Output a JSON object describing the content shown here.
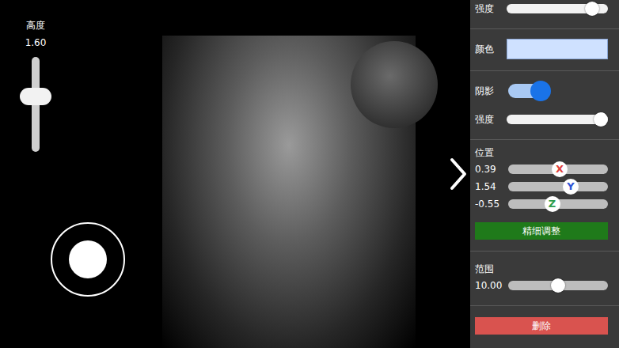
{
  "height_control": {
    "label": "高度",
    "value": "1.60",
    "level": 0.6
  },
  "light_panel": {
    "intensity": {
      "label": "强度",
      "level": 0.9
    },
    "color": {
      "label": "颜色",
      "swatch": "#cfe1ff"
    },
    "shadow": {
      "label": "阴影",
      "on": true
    },
    "shadow_strength": {
      "label": "强度",
      "level": 1.0
    },
    "position": {
      "label": "位置",
      "axes": [
        {
          "value": "0.39",
          "axis": "X",
          "level": 0.52,
          "color": "#e0403a"
        },
        {
          "value": "1.54",
          "axis": "Y",
          "level": 0.65,
          "color": "#2f54d6"
        },
        {
          "value": "-0.55",
          "axis": "Z",
          "level": 0.43,
          "color": "#2e9e4f"
        }
      ]
    },
    "fine_tune_button": "精细调整",
    "range": {
      "label": "范围",
      "value": "10.00",
      "level": 0.5
    },
    "delete_button": "删除"
  }
}
